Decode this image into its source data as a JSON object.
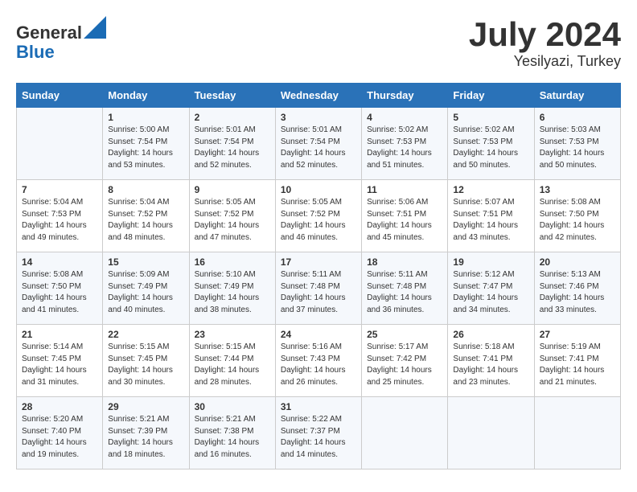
{
  "header": {
    "logo_line1": "General",
    "logo_line2": "Blue",
    "title": "July 2024",
    "location": "Yesilyazi, Turkey"
  },
  "weekdays": [
    "Sunday",
    "Monday",
    "Tuesday",
    "Wednesday",
    "Thursday",
    "Friday",
    "Saturday"
  ],
  "weeks": [
    [
      {
        "day": "",
        "sunrise": "",
        "sunset": "",
        "daylight": ""
      },
      {
        "day": "1",
        "sunrise": "Sunrise: 5:00 AM",
        "sunset": "Sunset: 7:54 PM",
        "daylight": "Daylight: 14 hours and 53 minutes."
      },
      {
        "day": "2",
        "sunrise": "Sunrise: 5:01 AM",
        "sunset": "Sunset: 7:54 PM",
        "daylight": "Daylight: 14 hours and 52 minutes."
      },
      {
        "day": "3",
        "sunrise": "Sunrise: 5:01 AM",
        "sunset": "Sunset: 7:54 PM",
        "daylight": "Daylight: 14 hours and 52 minutes."
      },
      {
        "day": "4",
        "sunrise": "Sunrise: 5:02 AM",
        "sunset": "Sunset: 7:53 PM",
        "daylight": "Daylight: 14 hours and 51 minutes."
      },
      {
        "day": "5",
        "sunrise": "Sunrise: 5:02 AM",
        "sunset": "Sunset: 7:53 PM",
        "daylight": "Daylight: 14 hours and 50 minutes."
      },
      {
        "day": "6",
        "sunrise": "Sunrise: 5:03 AM",
        "sunset": "Sunset: 7:53 PM",
        "daylight": "Daylight: 14 hours and 50 minutes."
      }
    ],
    [
      {
        "day": "7",
        "sunrise": "Sunrise: 5:04 AM",
        "sunset": "Sunset: 7:53 PM",
        "daylight": "Daylight: 14 hours and 49 minutes."
      },
      {
        "day": "8",
        "sunrise": "Sunrise: 5:04 AM",
        "sunset": "Sunset: 7:52 PM",
        "daylight": "Daylight: 14 hours and 48 minutes."
      },
      {
        "day": "9",
        "sunrise": "Sunrise: 5:05 AM",
        "sunset": "Sunset: 7:52 PM",
        "daylight": "Daylight: 14 hours and 47 minutes."
      },
      {
        "day": "10",
        "sunrise": "Sunrise: 5:05 AM",
        "sunset": "Sunset: 7:52 PM",
        "daylight": "Daylight: 14 hours and 46 minutes."
      },
      {
        "day": "11",
        "sunrise": "Sunrise: 5:06 AM",
        "sunset": "Sunset: 7:51 PM",
        "daylight": "Daylight: 14 hours and 45 minutes."
      },
      {
        "day": "12",
        "sunrise": "Sunrise: 5:07 AM",
        "sunset": "Sunset: 7:51 PM",
        "daylight": "Daylight: 14 hours and 43 minutes."
      },
      {
        "day": "13",
        "sunrise": "Sunrise: 5:08 AM",
        "sunset": "Sunset: 7:50 PM",
        "daylight": "Daylight: 14 hours and 42 minutes."
      }
    ],
    [
      {
        "day": "14",
        "sunrise": "Sunrise: 5:08 AM",
        "sunset": "Sunset: 7:50 PM",
        "daylight": "Daylight: 14 hours and 41 minutes."
      },
      {
        "day": "15",
        "sunrise": "Sunrise: 5:09 AM",
        "sunset": "Sunset: 7:49 PM",
        "daylight": "Daylight: 14 hours and 40 minutes."
      },
      {
        "day": "16",
        "sunrise": "Sunrise: 5:10 AM",
        "sunset": "Sunset: 7:49 PM",
        "daylight": "Daylight: 14 hours and 38 minutes."
      },
      {
        "day": "17",
        "sunrise": "Sunrise: 5:11 AM",
        "sunset": "Sunset: 7:48 PM",
        "daylight": "Daylight: 14 hours and 37 minutes."
      },
      {
        "day": "18",
        "sunrise": "Sunrise: 5:11 AM",
        "sunset": "Sunset: 7:48 PM",
        "daylight": "Daylight: 14 hours and 36 minutes."
      },
      {
        "day": "19",
        "sunrise": "Sunrise: 5:12 AM",
        "sunset": "Sunset: 7:47 PM",
        "daylight": "Daylight: 14 hours and 34 minutes."
      },
      {
        "day": "20",
        "sunrise": "Sunrise: 5:13 AM",
        "sunset": "Sunset: 7:46 PM",
        "daylight": "Daylight: 14 hours and 33 minutes."
      }
    ],
    [
      {
        "day": "21",
        "sunrise": "Sunrise: 5:14 AM",
        "sunset": "Sunset: 7:45 PM",
        "daylight": "Daylight: 14 hours and 31 minutes."
      },
      {
        "day": "22",
        "sunrise": "Sunrise: 5:15 AM",
        "sunset": "Sunset: 7:45 PM",
        "daylight": "Daylight: 14 hours and 30 minutes."
      },
      {
        "day": "23",
        "sunrise": "Sunrise: 5:15 AM",
        "sunset": "Sunset: 7:44 PM",
        "daylight": "Daylight: 14 hours and 28 minutes."
      },
      {
        "day": "24",
        "sunrise": "Sunrise: 5:16 AM",
        "sunset": "Sunset: 7:43 PM",
        "daylight": "Daylight: 14 hours and 26 minutes."
      },
      {
        "day": "25",
        "sunrise": "Sunrise: 5:17 AM",
        "sunset": "Sunset: 7:42 PM",
        "daylight": "Daylight: 14 hours and 25 minutes."
      },
      {
        "day": "26",
        "sunrise": "Sunrise: 5:18 AM",
        "sunset": "Sunset: 7:41 PM",
        "daylight": "Daylight: 14 hours and 23 minutes."
      },
      {
        "day": "27",
        "sunrise": "Sunrise: 5:19 AM",
        "sunset": "Sunset: 7:41 PM",
        "daylight": "Daylight: 14 hours and 21 minutes."
      }
    ],
    [
      {
        "day": "28",
        "sunrise": "Sunrise: 5:20 AM",
        "sunset": "Sunset: 7:40 PM",
        "daylight": "Daylight: 14 hours and 19 minutes."
      },
      {
        "day": "29",
        "sunrise": "Sunrise: 5:21 AM",
        "sunset": "Sunset: 7:39 PM",
        "daylight": "Daylight: 14 hours and 18 minutes."
      },
      {
        "day": "30",
        "sunrise": "Sunrise: 5:21 AM",
        "sunset": "Sunset: 7:38 PM",
        "daylight": "Daylight: 14 hours and 16 minutes."
      },
      {
        "day": "31",
        "sunrise": "Sunrise: 5:22 AM",
        "sunset": "Sunset: 7:37 PM",
        "daylight": "Daylight: 14 hours and 14 minutes."
      },
      {
        "day": "",
        "sunrise": "",
        "sunset": "",
        "daylight": ""
      },
      {
        "day": "",
        "sunrise": "",
        "sunset": "",
        "daylight": ""
      },
      {
        "day": "",
        "sunrise": "",
        "sunset": "",
        "daylight": ""
      }
    ]
  ]
}
